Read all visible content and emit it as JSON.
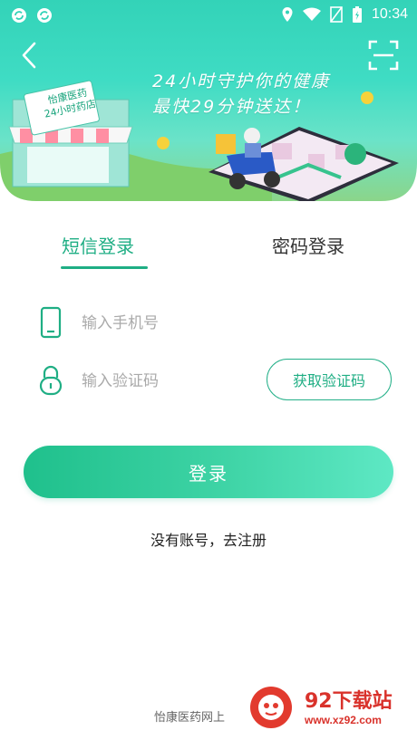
{
  "status_bar": {
    "time": "10:34",
    "icons": [
      "sync-icon",
      "sync-icon",
      "location-icon",
      "wifi-icon",
      "no-sim-icon",
      "battery-charging-icon"
    ]
  },
  "banner": {
    "slogan_line1": "24小时守护你的健康",
    "slogan_line2": "最快29分钟送达！",
    "store_sign_line1": "怡康医药",
    "store_sign_line2": "24小时药店",
    "back_icon": "chevron-left-icon",
    "scan_icon": "scan-icon"
  },
  "tabs": [
    {
      "label": "短信登录",
      "active": true
    },
    {
      "label": "密码登录",
      "active": false
    }
  ],
  "form": {
    "phone_placeholder": "输入手机号",
    "code_placeholder": "输入验证码",
    "get_code_label": "获取验证码",
    "submit_label": "登录"
  },
  "register_text": "没有账号，去注册",
  "footer_text": "怡康医药网上",
  "watermark": {
    "title": "92下载站",
    "url": "www.xz92.com"
  },
  "colors": {
    "accent": "#1fae84",
    "banner_top": "#33d3b8",
    "watermark_red": "#d9322b"
  }
}
